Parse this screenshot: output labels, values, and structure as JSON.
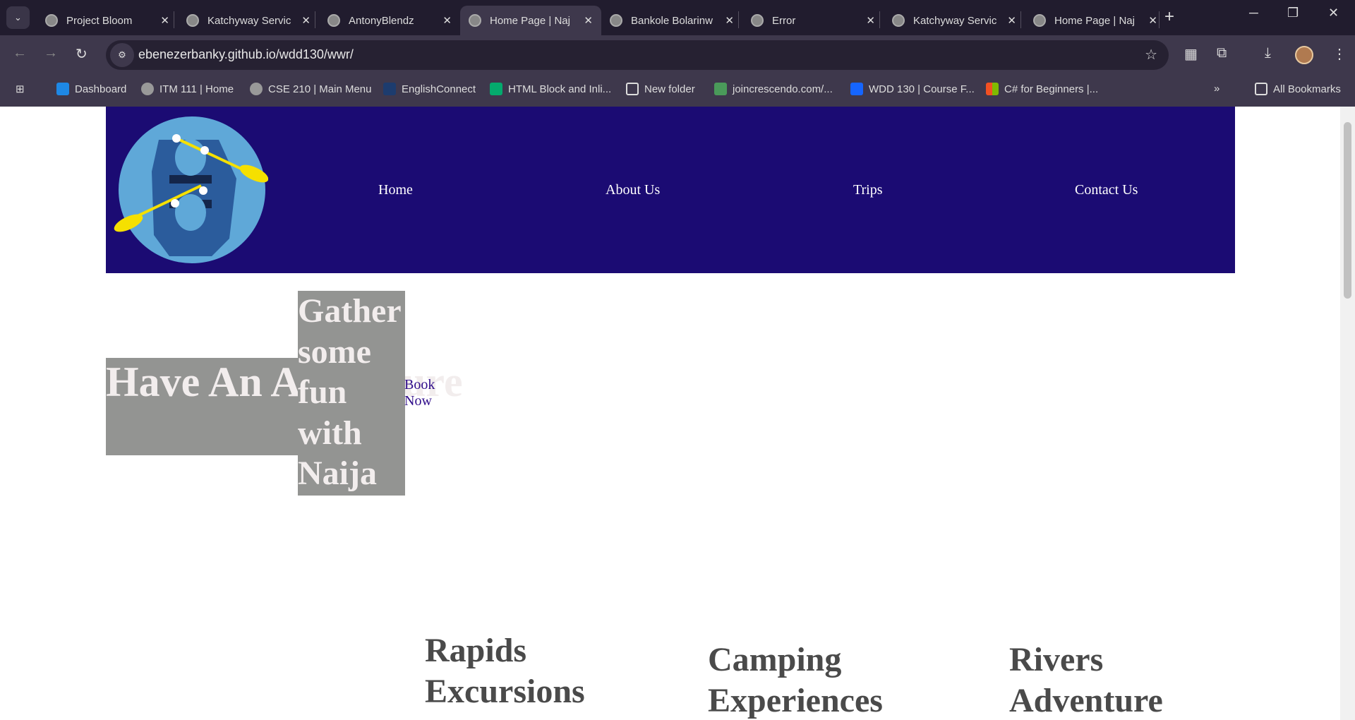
{
  "browser": {
    "tabs": [
      {
        "title": "Project Bloom"
      },
      {
        "title": "Katchyway Servic"
      },
      {
        "title": "AntonyBlendz"
      },
      {
        "title": "Home Page | Naj",
        "active": true
      },
      {
        "title": "Bankole Bolarinw"
      },
      {
        "title": "Error"
      },
      {
        "title": "Katchyway Servic"
      },
      {
        "title": "Home Page | Naj"
      }
    ],
    "url": "ebenezerbanky.github.io/wdd130/wwr/",
    "bookmarks": [
      {
        "label": "Dashboard",
        "color": "#1e88e5"
      },
      {
        "label": "ITM 111 | Home",
        "color": "#999999"
      },
      {
        "label": "CSE 210 | Main Menu",
        "color": "#999999"
      },
      {
        "label": "EnglishConnect",
        "color": "#1d3c6e"
      },
      {
        "label": "HTML Block and Inli...",
        "color": "#04aa6d"
      },
      {
        "label": "New folder",
        "color": "transparent"
      },
      {
        "label": "joincrescendo.com/...",
        "color": "#4a9a5a"
      },
      {
        "label": "WDD 130 | Course F...",
        "color": "#1565ff"
      },
      {
        "label": "C# for Beginners |...",
        "color": "#f25022"
      }
    ],
    "all_bookmarks": "All Bookmarks"
  },
  "site": {
    "header_bg": "#1b0b73",
    "nav": [
      "Home",
      "About Us",
      "Trips",
      "Contact Us"
    ],
    "hero_title": "Have An Adventure",
    "hero_subtitle": "Gather some fun with Naija",
    "cta": "Book Now",
    "features": [
      "Rapids Excursions",
      "Camping Experiences",
      "Rivers Adventure"
    ]
  }
}
